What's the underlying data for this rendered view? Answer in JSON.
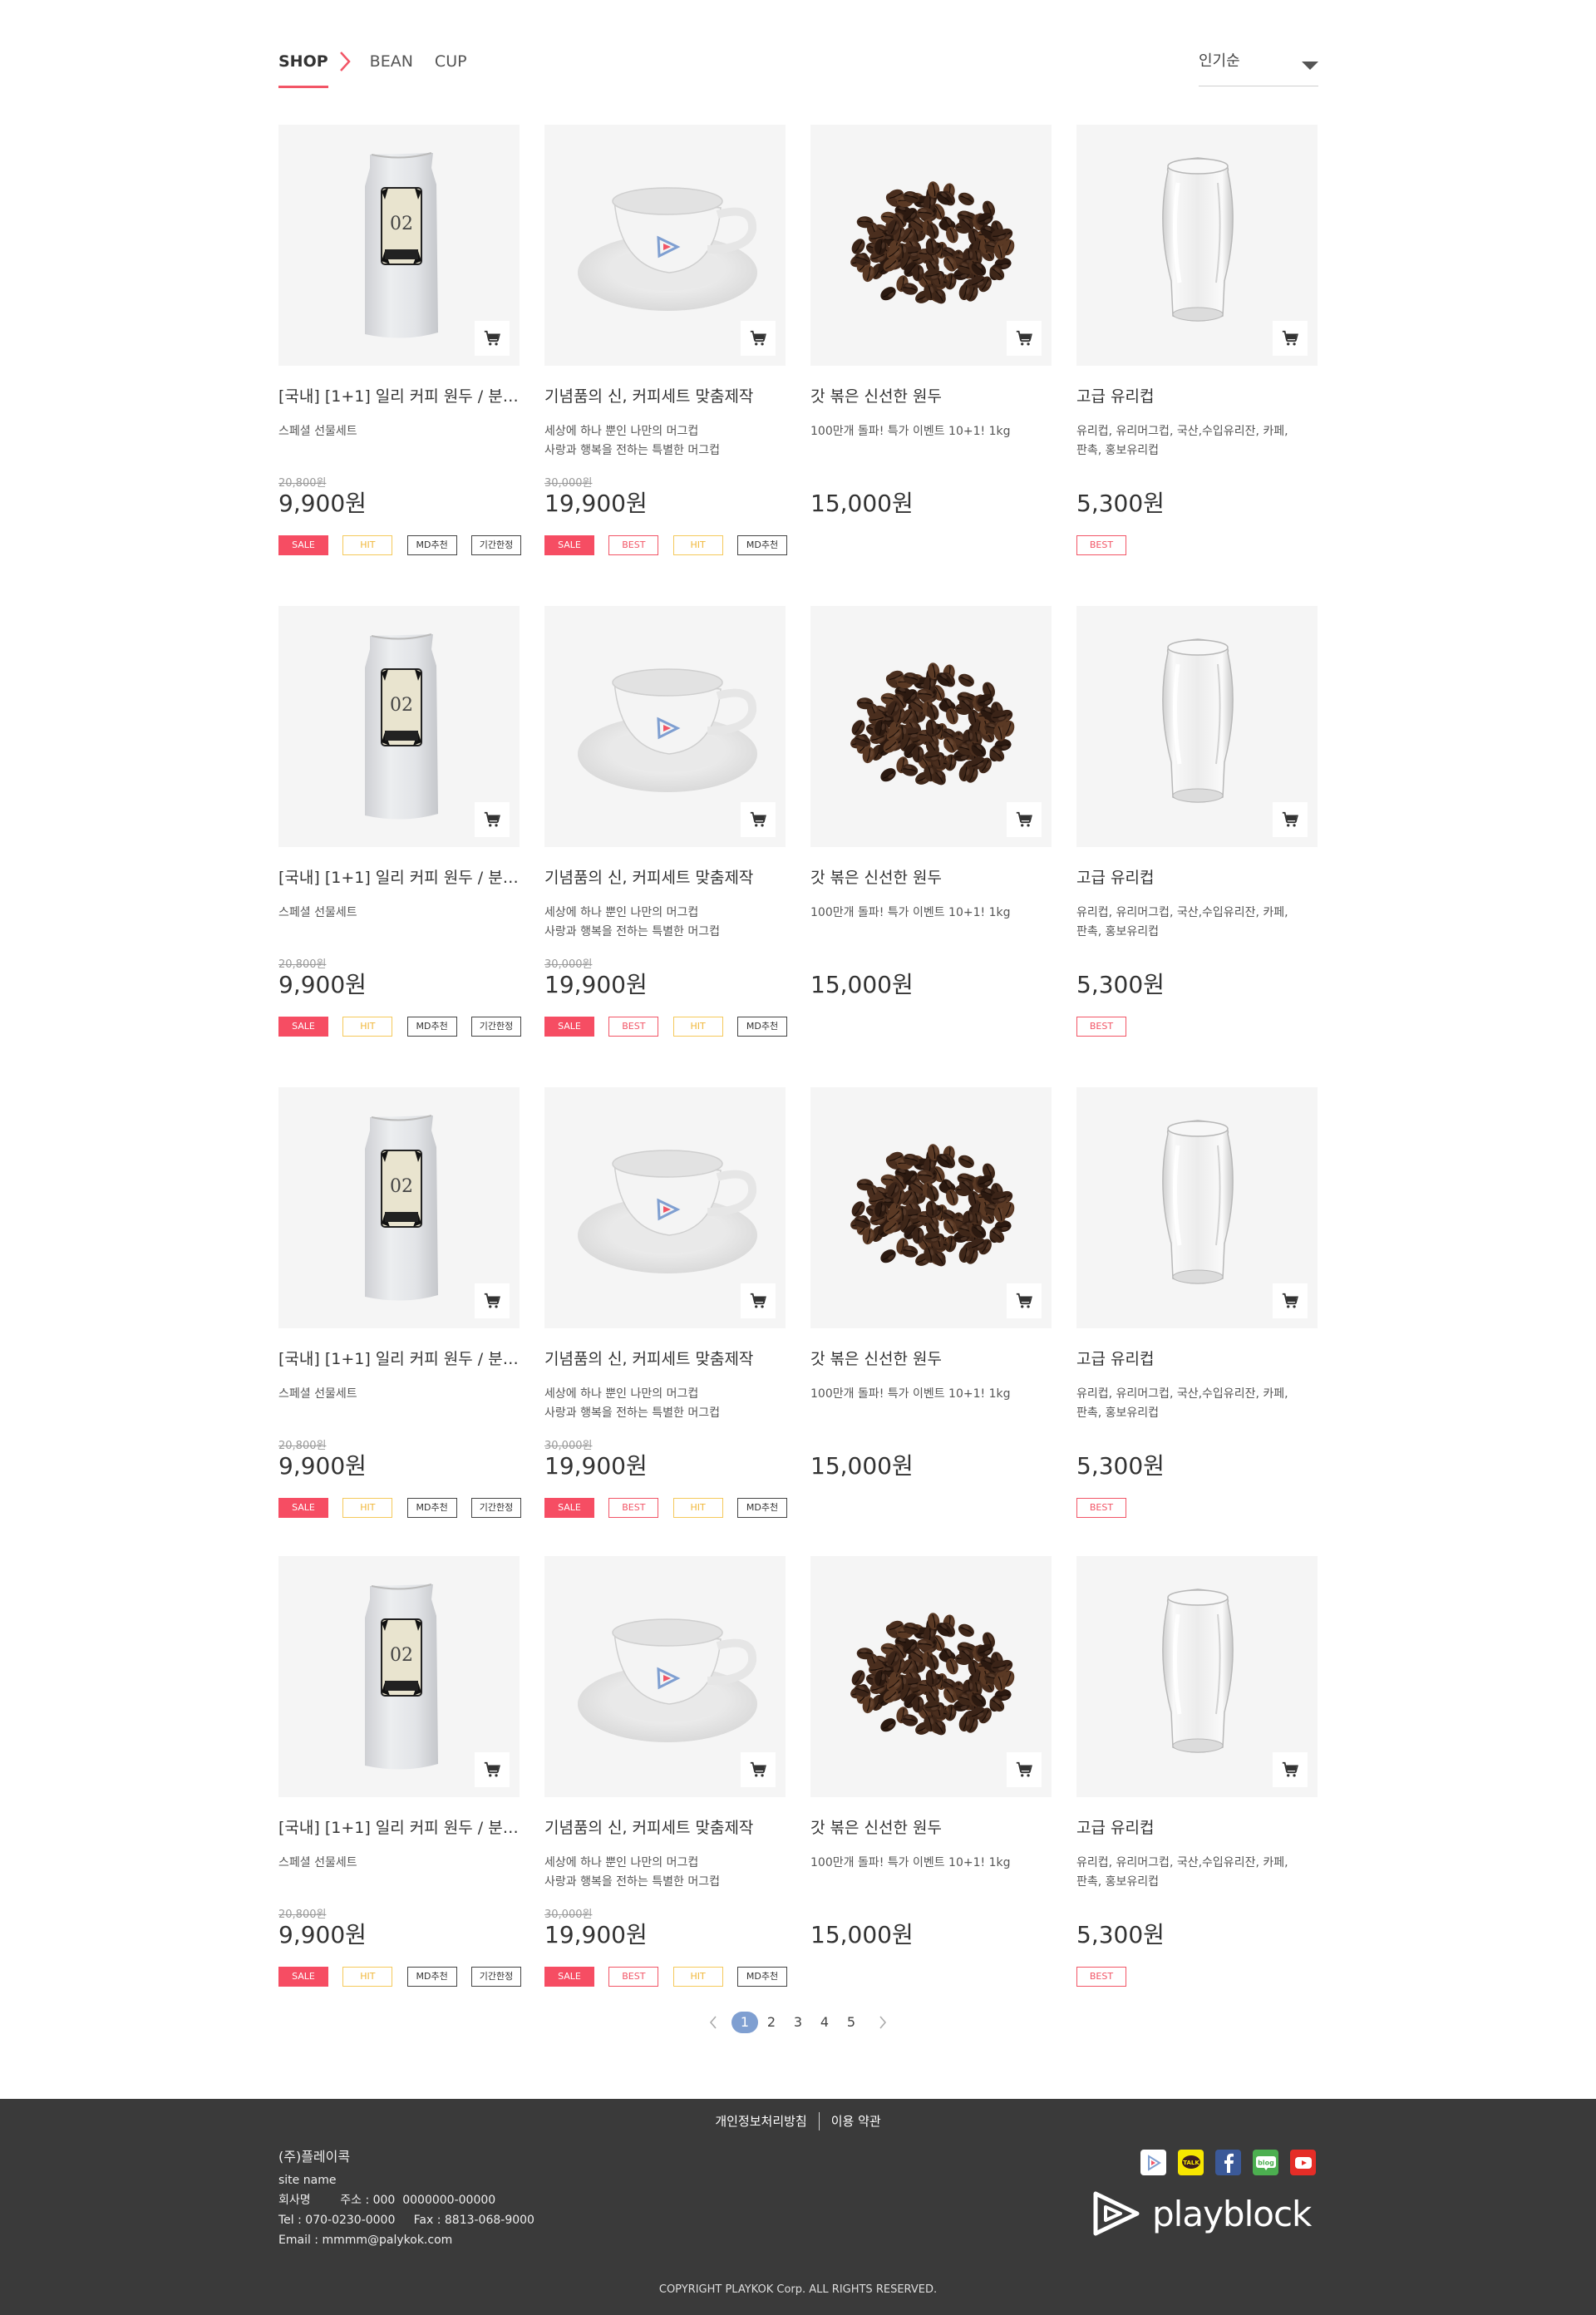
{
  "nav": {
    "crumbs": [
      "SHOP",
      "BEAN",
      "CUP"
    ],
    "sort": {
      "selected": "인기순"
    }
  },
  "products": [
    {
      "kind": "bag",
      "name": "[국내] [1+1] 일리 커피 원두 / 분말 …",
      "desc": "스페셜 선물세트",
      "orig_price": "20,800원",
      "price": "9,900원",
      "badges": [
        {
          "label": "SALE",
          "type": "sale"
        },
        {
          "label": "HIT",
          "type": "hit"
        },
        {
          "label": "MD추천",
          "type": "md"
        },
        {
          "label": "기간한정",
          "type": "limited"
        }
      ]
    },
    {
      "kind": "cup",
      "name": "기념품의 신, 커피세트 맞춤제작",
      "desc": "세상에 하나 뿐인 나만의 머그컵\n사랑과 행복을 전하는 특별한 머그컵",
      "orig_price": "30,000원",
      "price": "19,900원",
      "badges": [
        {
          "label": "SALE",
          "type": "sale"
        },
        {
          "label": "BEST",
          "type": "best"
        },
        {
          "label": "HIT",
          "type": "hit"
        },
        {
          "label": "MD추천",
          "type": "md"
        }
      ]
    },
    {
      "kind": "beans",
      "name": "갓 볶은 신선한 원두",
      "desc": "100만개 돌파! 특가 이벤트 10+1! 1kg",
      "orig_price": "",
      "price": "15,000원",
      "badges": []
    },
    {
      "kind": "glass",
      "name": "고급 유리컵",
      "desc": "유리컵, 유리머그컵, 국산,수입유리잔, 카페,\n판촉, 홍보유리컵",
      "orig_price": "",
      "price": "5,300원",
      "badges": [
        {
          "label": "BEST",
          "type": "best"
        }
      ]
    }
  ],
  "pagination": {
    "pages": [
      "1",
      "2",
      "3",
      "4",
      "5"
    ],
    "current": "1"
  },
  "footer": {
    "links": [
      "개인정보처리방침",
      "이용 약관"
    ],
    "company": "(주)플레이콕",
    "lines": [
      "site name",
      "회사명        주소 : 000  0000000-00000",
      "Tel : 070-0230-0000     Fax : 8813-068-9000",
      "Email : mmmm@palykok.com"
    ],
    "social": [
      {
        "icon": "playblock-icon",
        "color": "#ffffff"
      },
      {
        "icon": "kakaotalk-icon",
        "color": "#f7e600"
      },
      {
        "icon": "facebook-icon",
        "color": "#3b5998"
      },
      {
        "icon": "blog-icon",
        "color": "#4caf50"
      },
      {
        "icon": "youtube-icon",
        "color": "#e52d27"
      }
    ],
    "logo_text": "playblock",
    "copyright": "COPYRIGHT PLAYKOK Corp. ALL RIGHTS RESERVED."
  },
  "colors": {
    "accent": "#f25566",
    "sale": "#f64d63",
    "hit": "#f0b73a",
    "page_active": "#7f9fd1",
    "footer_bg": "#3a3a3a"
  }
}
